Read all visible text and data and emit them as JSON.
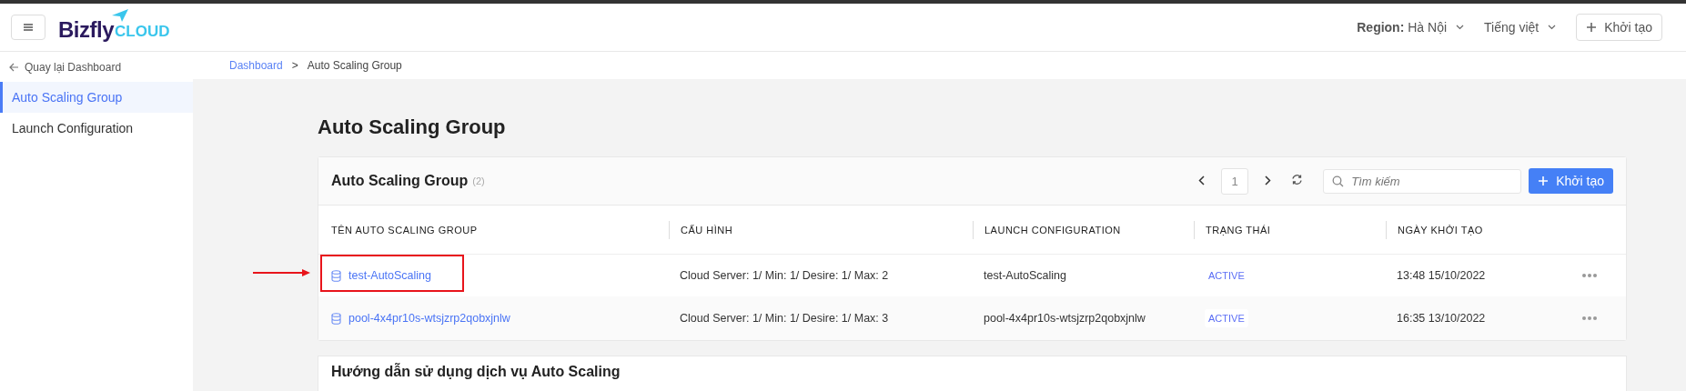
{
  "header": {
    "logo": {
      "brand": "Bizfly",
      "product": "CLOUD"
    },
    "region": "**Region:** Hà Nội",
    "language": "Tiếng việt",
    "create_button": "Khởi tạo"
  },
  "sidebar": {
    "back_link": "Quay lại Dashboard",
    "items": [
      {
        "label": "Auto Scaling Group",
        "selected": true
      },
      {
        "label": "Launch Configuration",
        "selected": false
      }
    ]
  },
  "breadcrumb": {
    "items": [
      {
        "label": "Dashboard",
        "kind": "link"
      },
      {
        "label": "Auto Scaling Group",
        "kind": "current"
      }
    ],
    "separator": ">"
  },
  "page_title": "Auto Scaling Group",
  "card": {
    "title": "Auto Scaling Group",
    "count": "(2)",
    "pagination": {
      "page": "1"
    },
    "search": {
      "placeholder": "Tìm kiếm"
    },
    "create_button": "Khởi tạo",
    "table": {
      "columns": [
        "TÊN AUTO SCALING GROUP",
        "CẤU HÌNH",
        "LAUNCH CONFIGURATION",
        "TRẠNG THÁI",
        "NGÀY KHỞI TẠO"
      ],
      "rows": [
        {
          "name": "test-AutoScaling",
          "config": "Cloud Server: 1/ Min: 1/ Desire: 1/ Max: 2",
          "launch_configuration": "test-AutoScaling",
          "status": "ACTIVE",
          "created": "13:48 15/10/2022",
          "highlighted": true
        },
        {
          "name": "pool-4x4pr10s-wtsjzrp2qobxjnlw",
          "config": "Cloud Server: 1/ Min: 1/ Desire: 1/ Max: 3",
          "launch_configuration": "pool-4x4pr10s-wtsjzrp2qobxjnlw",
          "status": "ACTIVE",
          "created": "16:35 13/10/2022",
          "highlighted": false
        }
      ]
    }
  },
  "guide": {
    "title": "Hướng dẫn sử dụng dịch vụ Auto Scaling"
  }
}
